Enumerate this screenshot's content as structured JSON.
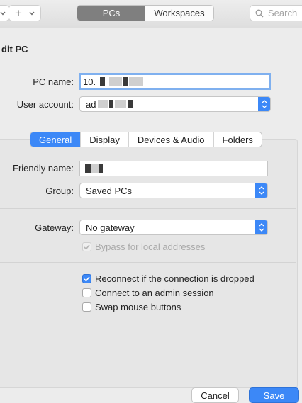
{
  "toolbar": {
    "segments": [
      "PCs",
      "Workspaces"
    ],
    "search_placeholder": "Search"
  },
  "sheet": {
    "title": "dit PC",
    "pc_name": {
      "label": "PC name:",
      "value": "10."
    },
    "user_account": {
      "label": "User account:",
      "value": "ad"
    },
    "tabs": [
      "General",
      "Display",
      "Devices & Audio",
      "Folders"
    ],
    "active_tab": "General",
    "friendly_name": {
      "label": "Friendly name:"
    },
    "group": {
      "label": "Group:",
      "value": "Saved PCs"
    },
    "gateway": {
      "label": "Gateway:",
      "value": "No gateway"
    },
    "bypass": {
      "label": "Bypass for local addresses",
      "checked": true,
      "enabled": false
    },
    "options": [
      {
        "label": "Reconnect if the connection is dropped",
        "checked": true
      },
      {
        "label": "Connect to an admin session",
        "checked": false
      },
      {
        "label": "Swap mouse buttons",
        "checked": false
      }
    ]
  },
  "buttons": {
    "cancel": "Cancel",
    "save": "Save"
  },
  "colors": {
    "accent": "#3c88f7",
    "segment_active": "#7f7f7f"
  }
}
